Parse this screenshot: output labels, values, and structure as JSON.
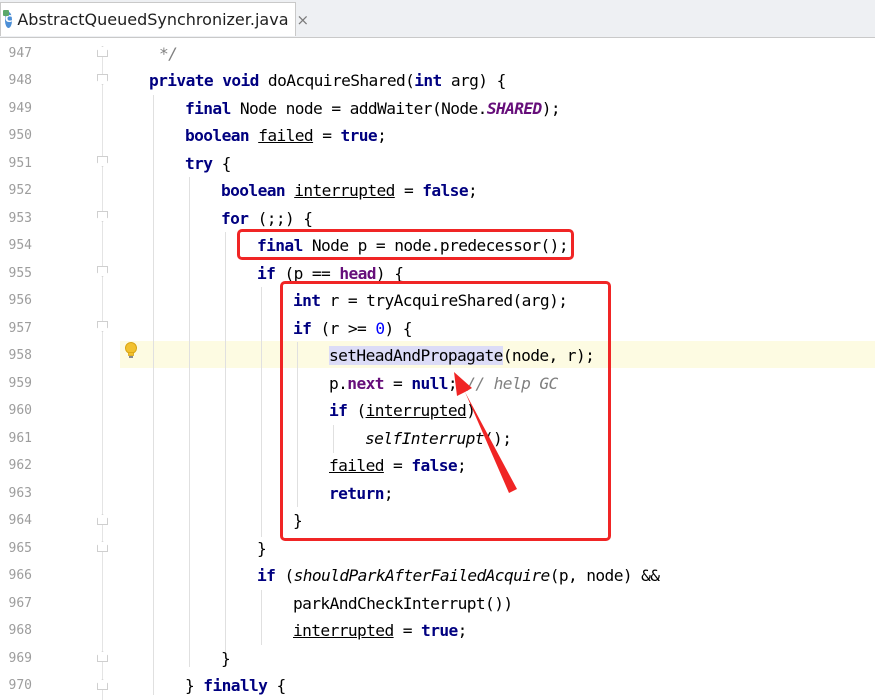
{
  "tab": {
    "title": "AbstractQueuedSynchronizer.java",
    "icon": "C",
    "close": "×"
  },
  "editor": {
    "line_numbers": [
      "947",
      "948",
      "949",
      "950",
      "951",
      "952",
      "953",
      "954",
      "955",
      "956",
      "957",
      "958",
      "959",
      "960",
      "961",
      "962",
      "963",
      "964",
      "965",
      "966",
      "967",
      "968",
      "969",
      "970"
    ],
    "lines": {
      "l947": "*/",
      "l948": {
        "a": "private",
        "b": " ",
        "c": "void",
        "d": " doAcquireShared(",
        "e": "int",
        "f": " arg) {"
      },
      "l949": {
        "a": "final",
        "b": " Node node = addWaiter(Node.",
        "c": "SHARED",
        "d": ");"
      },
      "l950": {
        "a": "boolean",
        "b": " ",
        "c": "failed",
        "d": " = ",
        "e": "true",
        "f": ";"
      },
      "l951": {
        "a": "try",
        "b": " {"
      },
      "l952": {
        "a": "boolean",
        "b": " ",
        "c": "interrupted",
        "d": " = ",
        "e": "false",
        "f": ";"
      },
      "l953": {
        "a": "for",
        "b": " (;;) {"
      },
      "l954": {
        "a": "final",
        "b": " Node p = node.predecessor();"
      },
      "l955": {
        "a": "if",
        "b": " (p == ",
        "c": "head",
        "d": ") {"
      },
      "l956": {
        "a": "int",
        "b": " r = tryAcquireShared(arg);"
      },
      "l957": {
        "a": "if",
        "b": " (r >= ",
        "c": "0",
        "d": ") {"
      },
      "l958": {
        "a": "setHeadAndPropagate",
        "b": "(node, r);"
      },
      "l959": {
        "a": "p.",
        "b": "next",
        "c": " = ",
        "d": "null",
        "e": "; ",
        "f": "// help GC"
      },
      "l960": {
        "a": "if",
        "b": " (",
        "c": "interrupted",
        "d": ")"
      },
      "l961": {
        "a": "selfInterrupt",
        "b": "();"
      },
      "l962": {
        "a": "failed",
        "b": " = ",
        "c": "false",
        "d": ";"
      },
      "l963": {
        "a": "return",
        "b": ";"
      },
      "l964": "}",
      "l965": "}",
      "l966": {
        "a": "if",
        "b": " (",
        "c": "shouldParkAfterFailedAcquire",
        "d": "(p, node) &&"
      },
      "l967": "parkAndCheckInterrupt())",
      "l968": {
        "a": "interrupted",
        "b": " = ",
        "c": "true",
        "d": ";"
      },
      "l969": "}",
      "l970": {
        "a": "} ",
        "b": "finally",
        "c": " {"
      }
    }
  },
  "colors": {
    "keyword": "#000080",
    "field": "#660e7a",
    "number": "#0000ff",
    "comment": "#808080",
    "annotation": "#f02525",
    "current_line": "#fdfbe2"
  },
  "icons": {
    "tab": "java-class-icon",
    "gutter": "lightbulb-icon"
  }
}
